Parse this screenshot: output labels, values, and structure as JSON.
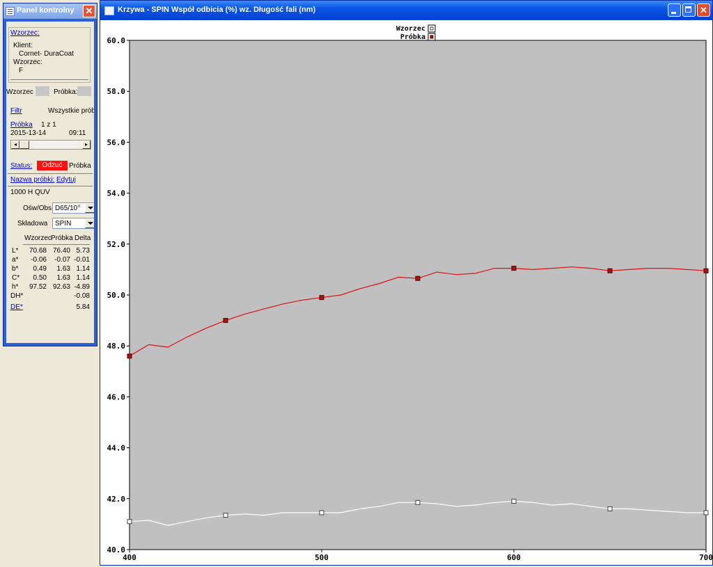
{
  "panel": {
    "title": "Panel kontrolny",
    "wzorzec_link": "Wzorzec:",
    "klient_label": "Klient:",
    "klient_value": "Cornet- DuraCoat",
    "wzorzec_label": "Wzorzec:",
    "wzorzec_value": "F",
    "wzorzec_swatch_label": "Wzorzec",
    "probka_swatch_label": "Próbka:",
    "filtr_link": "Filtr",
    "filtr_value": "Wszystkie próbki",
    "probka_label": "Próbka",
    "probka_counter": "1 z 1",
    "date": "2015-13-14",
    "time": "09:11",
    "status_link": "Status:",
    "status_badge": "Odzuć",
    "status_after": "Próbka",
    "nazwa_link": "Nazwa próbki:",
    "edytuj_link": "Edytuj",
    "sample_name": "1000 H QUV",
    "illum_label": "Ośw/Obs:",
    "illum_value": "D65/10°",
    "skladowa_label": "Składowa",
    "skladowa_value": "SPIN",
    "table": {
      "headers": [
        "Wzorzec",
        "Próbka",
        "Delta"
      ],
      "rows": [
        {
          "label": "L*",
          "wzorzec": "70.68",
          "probka": "76.40",
          "delta": "5.73"
        },
        {
          "label": "a*",
          "wzorzec": "-0.06",
          "probka": "-0.07",
          "delta": "-0.01"
        },
        {
          "label": "b*",
          "wzorzec": "0.49",
          "probka": "1.63",
          "delta": "1.14"
        },
        {
          "label": "C*",
          "wzorzec": "0.50",
          "probka": "1.63",
          "delta": "1.14"
        },
        {
          "label": "h*",
          "wzorzec": "97.52",
          "probka": "92.63",
          "delta": "-4.89"
        },
        {
          "label": "DH*",
          "wzorzec": "",
          "probka": "",
          "delta": "-0.08"
        }
      ],
      "de_label": "DE*",
      "de_value": "5.84"
    }
  },
  "chart_window": {
    "title": "Krzywa - SPIN Współ odbicia (%) wz. Długość fali (nm)"
  },
  "colors": {
    "probka": "#dd1111",
    "wzorzec": "#ffffff",
    "plot_bg": "#c0c0c0"
  },
  "chart_data": {
    "type": "line",
    "title": "Krzywa - SPIN Współ odbicia (%) wz. Długość fali (nm)",
    "xlabel": "",
    "ylabel": "",
    "xlim": [
      400,
      700
    ],
    "ylim": [
      40,
      60
    ],
    "xticks": [
      "400",
      "500",
      "600",
      "700"
    ],
    "yticks": [
      "40.0",
      "42.0",
      "44.0",
      "46.0",
      "48.0",
      "50.0",
      "52.0",
      "54.0",
      "56.0",
      "58.0",
      "60.0"
    ],
    "legend_position": "top-center",
    "grid": false,
    "series": [
      {
        "name": "Wzorzec",
        "x": [
          400,
          410,
          420,
          430,
          440,
          450,
          460,
          470,
          480,
          490,
          500,
          510,
          520,
          530,
          540,
          550,
          560,
          570,
          580,
          590,
          600,
          610,
          620,
          630,
          640,
          650,
          660,
          670,
          680,
          690,
          700
        ],
        "y": [
          41.1,
          41.15,
          40.95,
          41.1,
          41.25,
          41.35,
          41.4,
          41.35,
          41.45,
          41.45,
          41.45,
          41.45,
          41.6,
          41.7,
          41.85,
          41.85,
          41.8,
          41.7,
          41.75,
          41.85,
          41.9,
          41.85,
          41.75,
          41.8,
          41.7,
          41.6,
          41.6,
          41.55,
          41.5,
          41.45,
          41.45
        ],
        "markers_at": [
          400,
          450,
          500,
          550,
          600,
          650,
          700
        ]
      },
      {
        "name": "Próbka",
        "x": [
          400,
          410,
          420,
          430,
          440,
          450,
          460,
          470,
          480,
          490,
          500,
          510,
          520,
          530,
          540,
          550,
          560,
          570,
          580,
          590,
          600,
          610,
          620,
          630,
          640,
          650,
          660,
          670,
          680,
          690,
          700
        ],
        "y": [
          47.6,
          48.05,
          47.95,
          48.35,
          48.7,
          49.0,
          49.25,
          49.45,
          49.65,
          49.8,
          49.9,
          50.0,
          50.25,
          50.45,
          50.7,
          50.65,
          50.9,
          50.8,
          50.85,
          51.05,
          51.05,
          51.0,
          51.05,
          51.1,
          51.05,
          50.95,
          51.0,
          51.05,
          51.05,
          51.0,
          50.95
        ],
        "markers_at": [
          400,
          450,
          500,
          550,
          600,
          650,
          700
        ]
      }
    ]
  }
}
